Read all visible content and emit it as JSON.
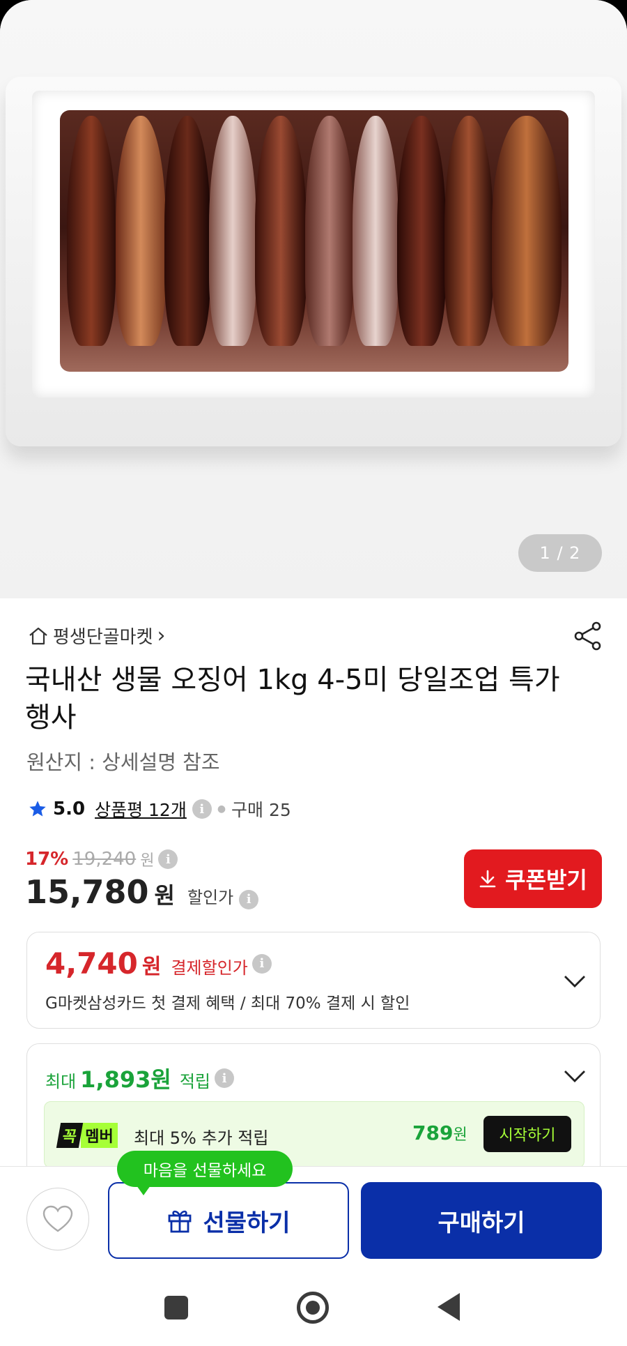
{
  "gallery": {
    "pager": "1 / 2"
  },
  "seller": {
    "name": "평생단골마켓",
    "chevron": "›"
  },
  "product": {
    "title": "국내산 생물 오징어 1kg 4-5미 당일조업 특가 행사",
    "origin": "원산지 : 상세설명 참조",
    "rating": "5.0",
    "review_label": "상품평 12개",
    "purchase_label": "구매 25"
  },
  "price": {
    "discount_pct": "17%",
    "original": "19,240",
    "original_unit": "원",
    "sale": "15,780",
    "sale_unit": "원",
    "sale_label": "할인가",
    "coupon_label": "쿠폰받기"
  },
  "payment_discount": {
    "amount": "4,740",
    "unit": "원",
    "label": "결제할인가",
    "description": "G마켓삼성카드 첫 결제 혜택 / 최대 70% 결제 시 할인"
  },
  "points": {
    "prefix": "최대",
    "amount": "1,893원",
    "suffix": "적립",
    "member_badge_1": "꼭",
    "member_badge_2": "멤버",
    "member_text": "최대 5% 추가 적립",
    "member_points": "789",
    "member_points_unit": "원",
    "start_label": "시작하기"
  },
  "actions": {
    "tooltip": "마음을 선물하세요",
    "gift_label": "선물하기",
    "buy_label": "구매하기"
  },
  "colors": {
    "accent_red": "#e21a1f",
    "primary_blue": "#0a2fa8",
    "point_green": "#1aa33a"
  }
}
